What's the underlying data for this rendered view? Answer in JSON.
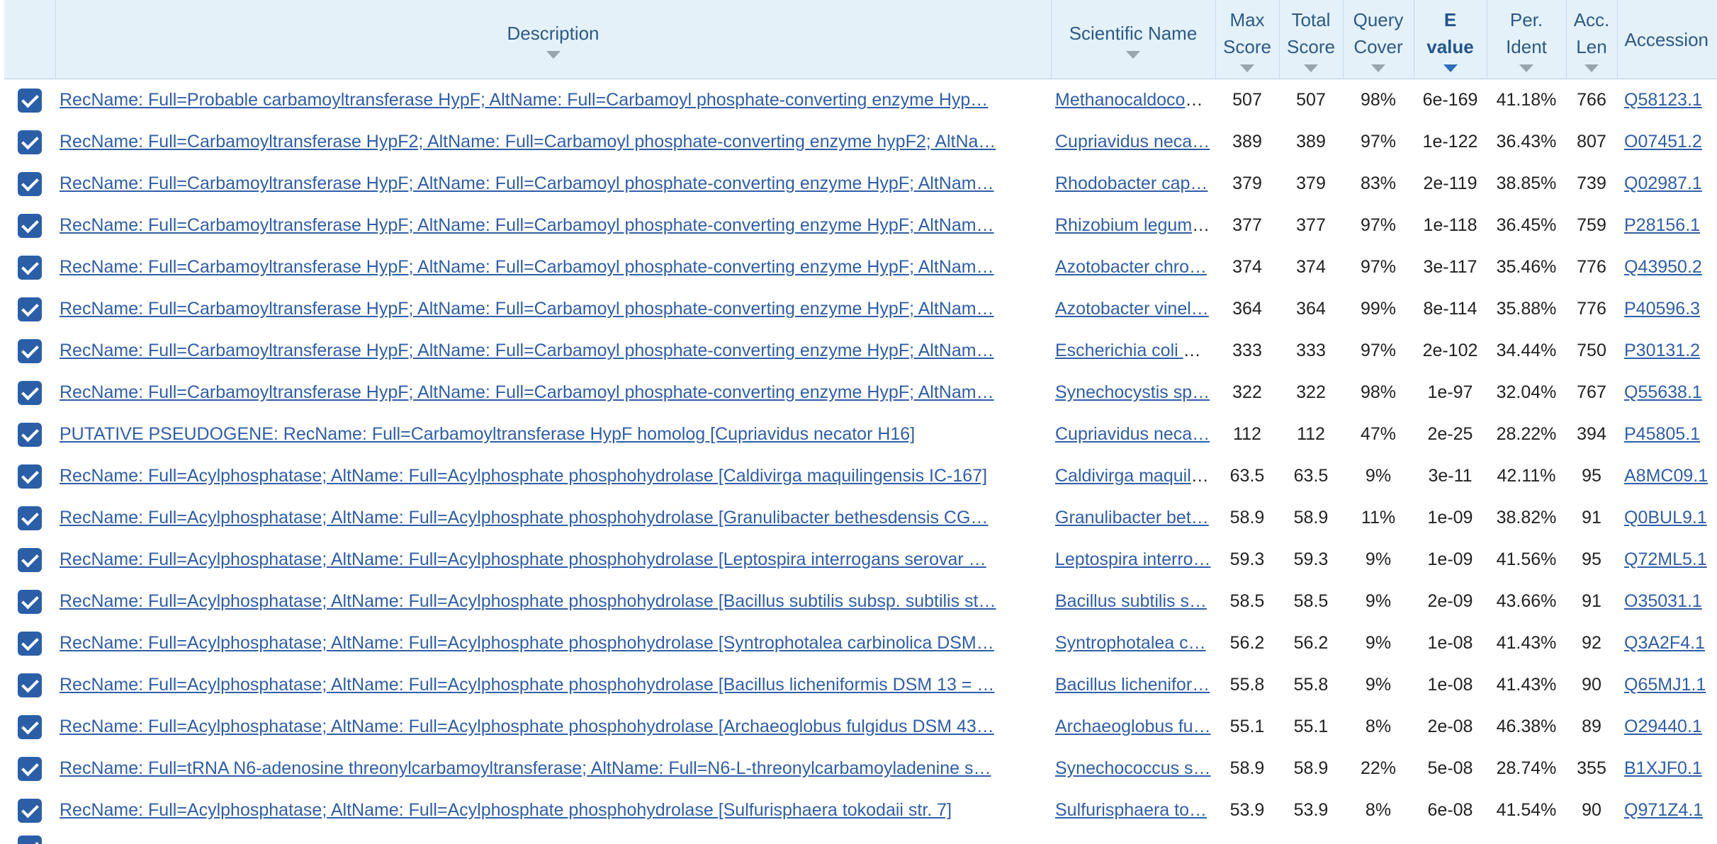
{
  "columns": {
    "description": "Description",
    "scientific_name": "Scientific Name",
    "max_score": [
      "Max",
      "Score"
    ],
    "total_score": [
      "Total",
      "Score"
    ],
    "query_cover": [
      "Query",
      "Cover"
    ],
    "e_value": [
      "E",
      "value"
    ],
    "per_ident": [
      "Per.",
      "Ident"
    ],
    "acc_len": [
      "Acc.",
      "Len"
    ],
    "accession": "Accession"
  },
  "sorted_column": "e_value",
  "colors": {
    "header_bg": "#e4f1f9",
    "link": "#2f5ea8",
    "checkbox": "#2a5fa8",
    "sort_active": "#2a6fbd"
  },
  "rows": [
    {
      "checked": true,
      "description": "RecName: Full=Probable carbamoyltransferase HypF; AltName: Full=Carbamoyl phosphate-converting enzyme Hyp…",
      "sci": "Methanocaldococ…",
      "max": "507",
      "total": "507",
      "cover": "98%",
      "evalue": "6e-169",
      "ident": "41.18%",
      "len": "766",
      "acc": "Q58123.1"
    },
    {
      "checked": true,
      "description": "RecName: Full=Carbamoyltransferase HypF2; AltName: Full=Carbamoyl phosphate-converting enzyme hypF2; AltNa…",
      "sci": "Cupriavidus neca…",
      "max": "389",
      "total": "389",
      "cover": "97%",
      "evalue": "1e-122",
      "ident": "36.43%",
      "len": "807",
      "acc": "O07451.2"
    },
    {
      "checked": true,
      "description": "RecName: Full=Carbamoyltransferase HypF; AltName: Full=Carbamoyl phosphate-converting enzyme HypF; AltNam…",
      "sci": "Rhodobacter cap…",
      "max": "379",
      "total": "379",
      "cover": "83%",
      "evalue": "2e-119",
      "ident": "38.85%",
      "len": "739",
      "acc": "Q02987.1"
    },
    {
      "checked": true,
      "description": "RecName: Full=Carbamoyltransferase HypF; AltName: Full=Carbamoyl phosphate-converting enzyme HypF; AltNam…",
      "sci": "Rhizobium legumi…",
      "max": "377",
      "total": "377",
      "cover": "97%",
      "evalue": "1e-118",
      "ident": "36.45%",
      "len": "759",
      "acc": "P28156.1"
    },
    {
      "checked": true,
      "description": "RecName: Full=Carbamoyltransferase HypF; AltName: Full=Carbamoyl phosphate-converting enzyme HypF; AltNam…",
      "sci": "Azotobacter chro…",
      "max": "374",
      "total": "374",
      "cover": "97%",
      "evalue": "3e-117",
      "ident": "35.46%",
      "len": "776",
      "acc": "Q43950.2"
    },
    {
      "checked": true,
      "description": "RecName: Full=Carbamoyltransferase HypF; AltName: Full=Carbamoyl phosphate-converting enzyme HypF; AltNam…",
      "sci": "Azotobacter vinel…",
      "max": "364",
      "total": "364",
      "cover": "99%",
      "evalue": "8e-114",
      "ident": "35.88%",
      "len": "776",
      "acc": "P40596.3"
    },
    {
      "checked": true,
      "description": "RecName: Full=Carbamoyltransferase HypF; AltName: Full=Carbamoyl phosphate-converting enzyme HypF; AltNam…",
      "sci": "Escherichia coli K…",
      "max": "333",
      "total": "333",
      "cover": "97%",
      "evalue": "2e-102",
      "ident": "34.44%",
      "len": "750",
      "acc": "P30131.2"
    },
    {
      "checked": true,
      "description": "RecName: Full=Carbamoyltransferase HypF; AltName: Full=Carbamoyl phosphate-converting enzyme HypF; AltNam…",
      "sci": "Synechocystis sp…",
      "max": "322",
      "total": "322",
      "cover": "98%",
      "evalue": "1e-97",
      "ident": "32.04%",
      "len": "767",
      "acc": "Q55638.1"
    },
    {
      "checked": true,
      "description": "PUTATIVE PSEUDOGENE: RecName: Full=Carbamoyltransferase HypF homolog [Cupriavidus necator H16]",
      "sci": "Cupriavidus neca…",
      "max": "112",
      "total": "112",
      "cover": "47%",
      "evalue": "2e-25",
      "ident": "28.22%",
      "len": "394",
      "acc": "P45805.1"
    },
    {
      "checked": true,
      "description": "RecName: Full=Acylphosphatase; AltName: Full=Acylphosphate phosphohydrolase [Caldivirga maquilingensis IC-167]",
      "sci": "Caldivirga maquili…",
      "max": "63.5",
      "total": "63.5",
      "cover": "9%",
      "evalue": "3e-11",
      "ident": "42.11%",
      "len": "95",
      "acc": "A8MC09.1"
    },
    {
      "checked": true,
      "description": "RecName: Full=Acylphosphatase; AltName: Full=Acylphosphate phosphohydrolase [Granulibacter bethesdensis CG…",
      "sci": "Granulibacter bet…",
      "max": "58.9",
      "total": "58.9",
      "cover": "11%",
      "evalue": "1e-09",
      "ident": "38.82%",
      "len": "91",
      "acc": "Q0BUL9.1"
    },
    {
      "checked": true,
      "description": "RecName: Full=Acylphosphatase; AltName: Full=Acylphosphate phosphohydrolase [Leptospira interrogans serovar …",
      "sci": "Leptospira interro…",
      "max": "59.3",
      "total": "59.3",
      "cover": "9%",
      "evalue": "1e-09",
      "ident": "41.56%",
      "len": "95",
      "acc": "Q72ML5.1"
    },
    {
      "checked": true,
      "description": "RecName: Full=Acylphosphatase; AltName: Full=Acylphosphate phosphohydrolase [Bacillus subtilis subsp. subtilis st…",
      "sci": "Bacillus subtilis s…",
      "max": "58.5",
      "total": "58.5",
      "cover": "9%",
      "evalue": "2e-09",
      "ident": "43.66%",
      "len": "91",
      "acc": "O35031.1"
    },
    {
      "checked": true,
      "description": "RecName: Full=Acylphosphatase; AltName: Full=Acylphosphate phosphohydrolase [Syntrophotalea carbinolica DSM…",
      "sci": "Syntrophotalea c…",
      "max": "56.2",
      "total": "56.2",
      "cover": "9%",
      "evalue": "1e-08",
      "ident": "41.43%",
      "len": "92",
      "acc": "Q3A2F4.1"
    },
    {
      "checked": true,
      "description": "RecName: Full=Acylphosphatase; AltName: Full=Acylphosphate phosphohydrolase [Bacillus licheniformis DSM 13 = …",
      "sci": "Bacillus lichenifor…",
      "max": "55.8",
      "total": "55.8",
      "cover": "9%",
      "evalue": "1e-08",
      "ident": "41.43%",
      "len": "90",
      "acc": "Q65MJ1.1"
    },
    {
      "checked": true,
      "description": "RecName: Full=Acylphosphatase; AltName: Full=Acylphosphate phosphohydrolase [Archaeoglobus fulgidus DSM 43…",
      "sci": "Archaeoglobus fu…",
      "max": "55.1",
      "total": "55.1",
      "cover": "8%",
      "evalue": "2e-08",
      "ident": "46.38%",
      "len": "89",
      "acc": "O29440.1"
    },
    {
      "checked": true,
      "description": "RecName: Full=tRNA N6-adenosine threonylcarbamoyltransferase; AltName: Full=N6-L-threonylcarbamoyladenine s…",
      "sci": "Synechococcus s…",
      "max": "58.9",
      "total": "58.9",
      "cover": "22%",
      "evalue": "5e-08",
      "ident": "28.74%",
      "len": "355",
      "acc": "B1XJF0.1"
    },
    {
      "checked": true,
      "description": "RecName: Full=Acylphosphatase; AltName: Full=Acylphosphate phosphohydrolase [Sulfurisphaera tokodaii str. 7]",
      "sci": "Sulfurisphaera to…",
      "max": "53.9",
      "total": "53.9",
      "cover": "8%",
      "evalue": "6e-08",
      "ident": "41.54%",
      "len": "90",
      "acc": "Q971Z4.1"
    }
  ]
}
